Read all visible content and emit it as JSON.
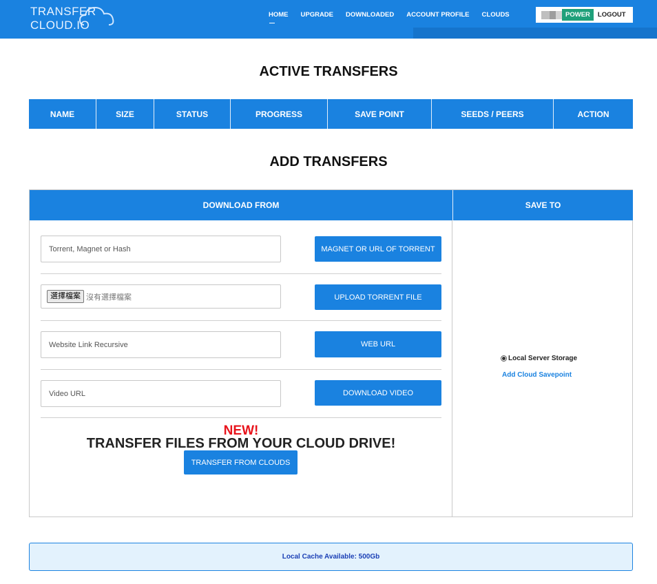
{
  "header": {
    "logo_text": "Transfer Cloud.io",
    "nav": [
      {
        "label": "HOME"
      },
      {
        "label": "UPGRADE"
      },
      {
        "label": "DOWNLOADED"
      },
      {
        "label": "ACCOUNT PROFILE"
      },
      {
        "label": "CLOUDS"
      }
    ],
    "power_label": "POWER",
    "logout_label": "LOGOUT"
  },
  "active_transfers": {
    "title": "ACTIVE TRANSFERS",
    "columns": [
      "NAME",
      "SIZE",
      "STATUS",
      "PROGRESS",
      "SAVE POINT",
      "SEEDS / PEERS",
      "ACTION"
    ]
  },
  "add_transfers": {
    "title": "ADD TRANSFERS",
    "download_from_label": "DOWNLOAD FROM",
    "save_to_label": "SAVE TO",
    "torrent_placeholder": "Torrent, Magnet or Hash",
    "magnet_button": "MAGNET OR URL OF TORRENT",
    "file_button_label": "選擇檔案",
    "file_none_label": "沒有選擇檔案",
    "upload_button": "UPLOAD TORRENT FILE",
    "website_placeholder": "Website Link Recursive",
    "web_url_button": "WEB URL",
    "video_placeholder": "Video URL",
    "download_video_button": "DOWNLOAD VIDEO",
    "new_label": "NEW!",
    "cloud_title": "TRANSFER FILES FROM YOUR CLOUD DRIVE!",
    "cloud_button": "TRANSFER FROM CLOUDS",
    "save_option_label": "Local Server Storage",
    "add_cloud_label": "Add Cloud Savepoint"
  },
  "cache": {
    "text": "Local Cache Available: 500Gb"
  },
  "colors": {
    "primary": "#1a82e0",
    "power": "#1fa07a",
    "new": "#e8131b",
    "cache_bg": "#e3f2fd"
  }
}
